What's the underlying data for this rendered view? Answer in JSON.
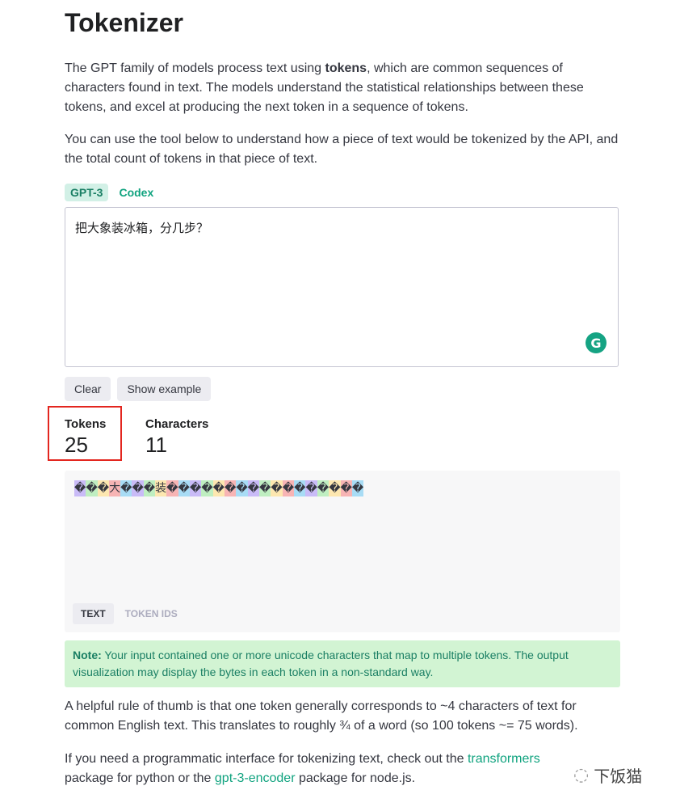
{
  "title": "Tokenizer",
  "intro": {
    "pre": "The GPT family of models process text using ",
    "bold": "tokens",
    "post": ", which are common sequences of characters found in text. The models understand the statistical relationships between these tokens, and excel at producing the next token in a sequence of tokens."
  },
  "intro2": "You can use the tool below to understand how a piece of text would be tokenized by the API, and the total count of tokens in that piece of text.",
  "model_tabs": [
    {
      "label": "GPT-3",
      "active": true
    },
    {
      "label": "Codex",
      "active": false
    }
  ],
  "input": {
    "value": "把大象装冰箱，分几步？"
  },
  "buttons": {
    "clear": "Clear",
    "example": "Show example"
  },
  "stats": {
    "tokens_label": "Tokens",
    "tokens": "25",
    "chars_label": "Characters",
    "chars": "11"
  },
  "tokens": [
    "�",
    "�",
    "�",
    "大",
    "�",
    "�",
    "�",
    "装",
    "�",
    "�",
    "�",
    "�",
    "�",
    "�",
    "�",
    "�",
    "�",
    "�",
    "�",
    "�",
    "�",
    "�",
    "�",
    "�",
    "�"
  ],
  "token_colors": [
    "#c9bbf7",
    "#bfeec1",
    "#fde7b0",
    "#f7b4b4",
    "#a8dcf5"
  ],
  "output_tabs": [
    {
      "label": "TEXT",
      "active": true
    },
    {
      "label": "TOKEN IDS",
      "active": false
    }
  ],
  "note": {
    "bold": "Note:",
    "text": " Your input contained one or more unicode characters that map to multiple tokens. The output visualization may display the bytes in each token in a non-standard way."
  },
  "rule": "A helpful rule of thumb is that one token generally corresponds to ~4 characters of text for common English text. This translates to roughly ¾ of a word (so 100 tokens ~= 75 words).",
  "prog": {
    "pre": "If you need a programmatic interface for tokenizing text, check out the ",
    "link1": "transformers",
    "mid": " package for python or the ",
    "link2": "gpt-3-encoder",
    "post": " package for node.js."
  },
  "watermark": "下饭猫"
}
